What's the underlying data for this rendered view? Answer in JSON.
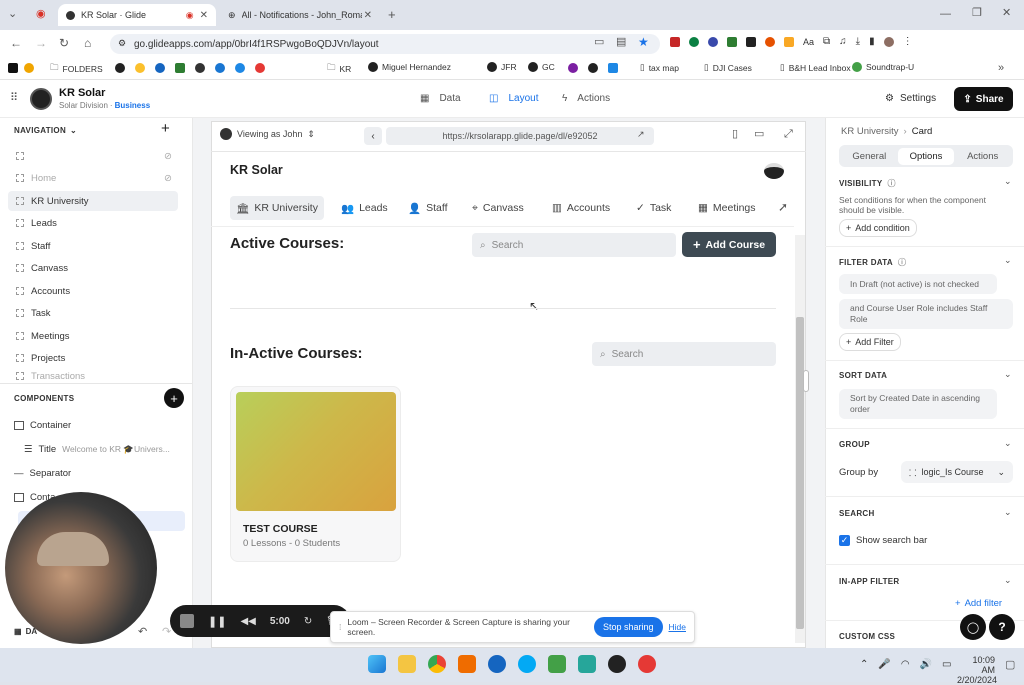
{
  "browser": {
    "tabs": [
      {
        "title": "KR Solar · Glide",
        "active": true
      },
      {
        "title": "All - Notifications - John_Roma",
        "active": false
      }
    ],
    "url": "go.glideapps.com/app/0brI4f1RSPwgoBoQDJVn/layout",
    "bookmarks": [
      "FOLDERS",
      "KR",
      "Miguel Hernandez",
      "JFR",
      "GC",
      "tax map",
      "DJI Cases",
      "B&H Lead Inbox",
      "Soundtrap-U"
    ]
  },
  "app": {
    "name": "KR Solar",
    "division": "Solar Division",
    "plan": "Business",
    "modes": [
      "Data",
      "Layout",
      "Actions"
    ],
    "active_mode": "Layout",
    "settings_label": "Settings",
    "share_label": "Share"
  },
  "left": {
    "nav_title": "NAVIGATION",
    "nav_items": [
      {
        "label": "",
        "hidden": true
      },
      {
        "label": "Home",
        "hidden": true
      },
      {
        "label": "KR University",
        "active": true
      },
      {
        "label": "Leads"
      },
      {
        "label": "Staff"
      },
      {
        "label": "Canvass"
      },
      {
        "label": "Accounts"
      },
      {
        "label": "Task"
      },
      {
        "label": "Meetings"
      },
      {
        "label": "Projects"
      },
      {
        "label": "Transactions"
      }
    ],
    "components_title": "COMPONENTS",
    "components": [
      {
        "label": "Container"
      },
      {
        "label": "Title",
        "sub": "Welcome to KR 🎓Univers..."
      },
      {
        "label": "Separator"
      },
      {
        "label": "Conta"
      }
    ],
    "data_label": "DA"
  },
  "preview": {
    "viewing_as": "Viewing as John",
    "url": "https://krsolarapp.glide.page/dl/e92052",
    "app_title": "KR Solar",
    "tabs": [
      "KR University",
      "Leads",
      "Staff",
      "Canvass",
      "Accounts",
      "Task",
      "Meetings"
    ],
    "active_title": "Active Courses:",
    "search_placeholder": "Search",
    "add_course_label": "Add Course",
    "inactive_title": "In-Active Courses:",
    "course": {
      "title": "TEST COURSE",
      "meta": "0 Lessons - 0 Students"
    }
  },
  "right": {
    "breadcrumb": [
      "KR University",
      "Card"
    ],
    "tabs": [
      "General",
      "Options",
      "Actions"
    ],
    "active_tab": "Options",
    "visibility": {
      "title": "VISIBILITY",
      "desc": "Set conditions for when the component should be visible.",
      "button": "Add condition"
    },
    "filter": {
      "title": "FILTER DATA",
      "conditions": [
        "In Draft (not active) is not checked",
        "and Course User Role includes Staff Role"
      ],
      "button": "Add Filter"
    },
    "sort": {
      "title": "SORT DATA",
      "value": "Sort by Created Date in ascending order"
    },
    "group": {
      "title": "GROUP",
      "label": "Group by",
      "value": "logic_Is Course"
    },
    "search": {
      "title": "SEARCH",
      "checkbox_label": "Show search bar"
    },
    "inapp": {
      "title": "IN-APP FILTER",
      "button": "Add filter"
    },
    "css": {
      "title": "CUSTOM CSS"
    }
  },
  "loom": {
    "timer": "5:00",
    "message": "Loom – Screen Recorder & Screen Capture is sharing your screen.",
    "stop_label": "Stop sharing",
    "hide_label": "Hide"
  },
  "taskbar": {
    "time": "10:09 AM",
    "date": "2/20/2024"
  },
  "colors": {
    "accent": "#1a73e8",
    "dark_button": "#3e4a53",
    "share_bg": "#111111"
  }
}
